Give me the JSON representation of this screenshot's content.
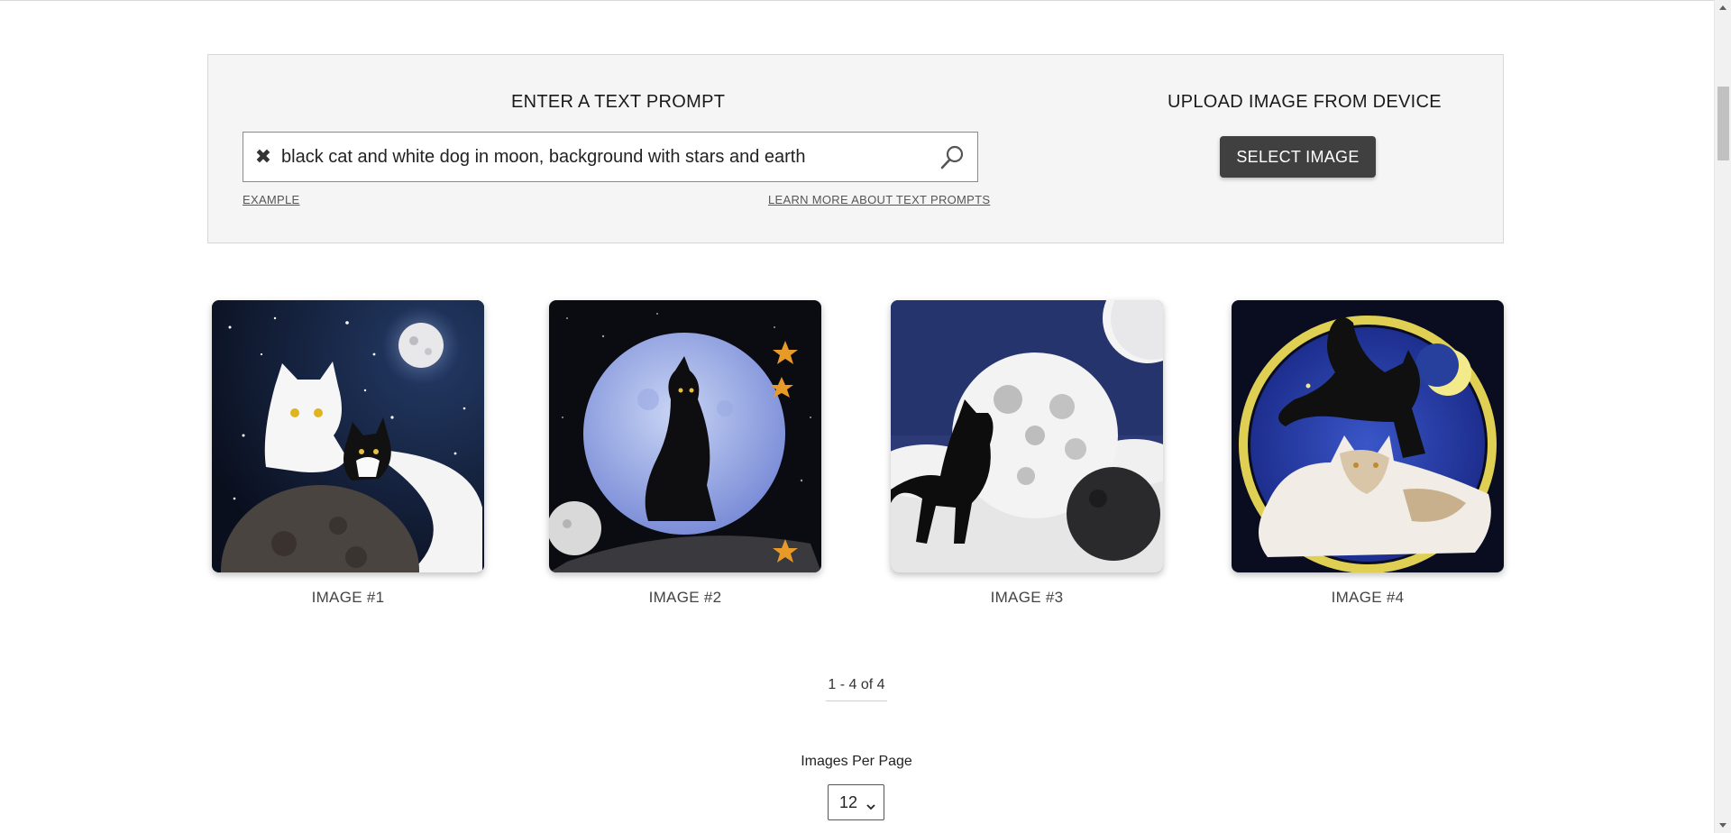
{
  "prompt_panel": {
    "text_heading": "ENTER A TEXT PROMPT",
    "search_value": "black cat and white dog in moon, background with stars and earth",
    "example_link": "EXAMPLE",
    "learn_more_link": "LEARN MORE ABOUT TEXT PROMPTS",
    "upload_heading": "UPLOAD IMAGE FROM DEVICE",
    "select_button": "SELECT IMAGE"
  },
  "gallery": {
    "images": [
      {
        "caption": "IMAGE #1"
      },
      {
        "caption": "IMAGE #2"
      },
      {
        "caption": "IMAGE #3"
      },
      {
        "caption": "IMAGE #4"
      }
    ]
  },
  "pagination": {
    "range_text": "1 - 4 of 4",
    "per_page_label": "Images Per Page",
    "per_page_value": "12"
  },
  "icons": {
    "clear": "close-icon",
    "search": "search-icon",
    "dropdown": "chevron-down-icon"
  },
  "colors": {
    "button_bg": "#404040",
    "panel_bg": "#f5f5f5"
  }
}
